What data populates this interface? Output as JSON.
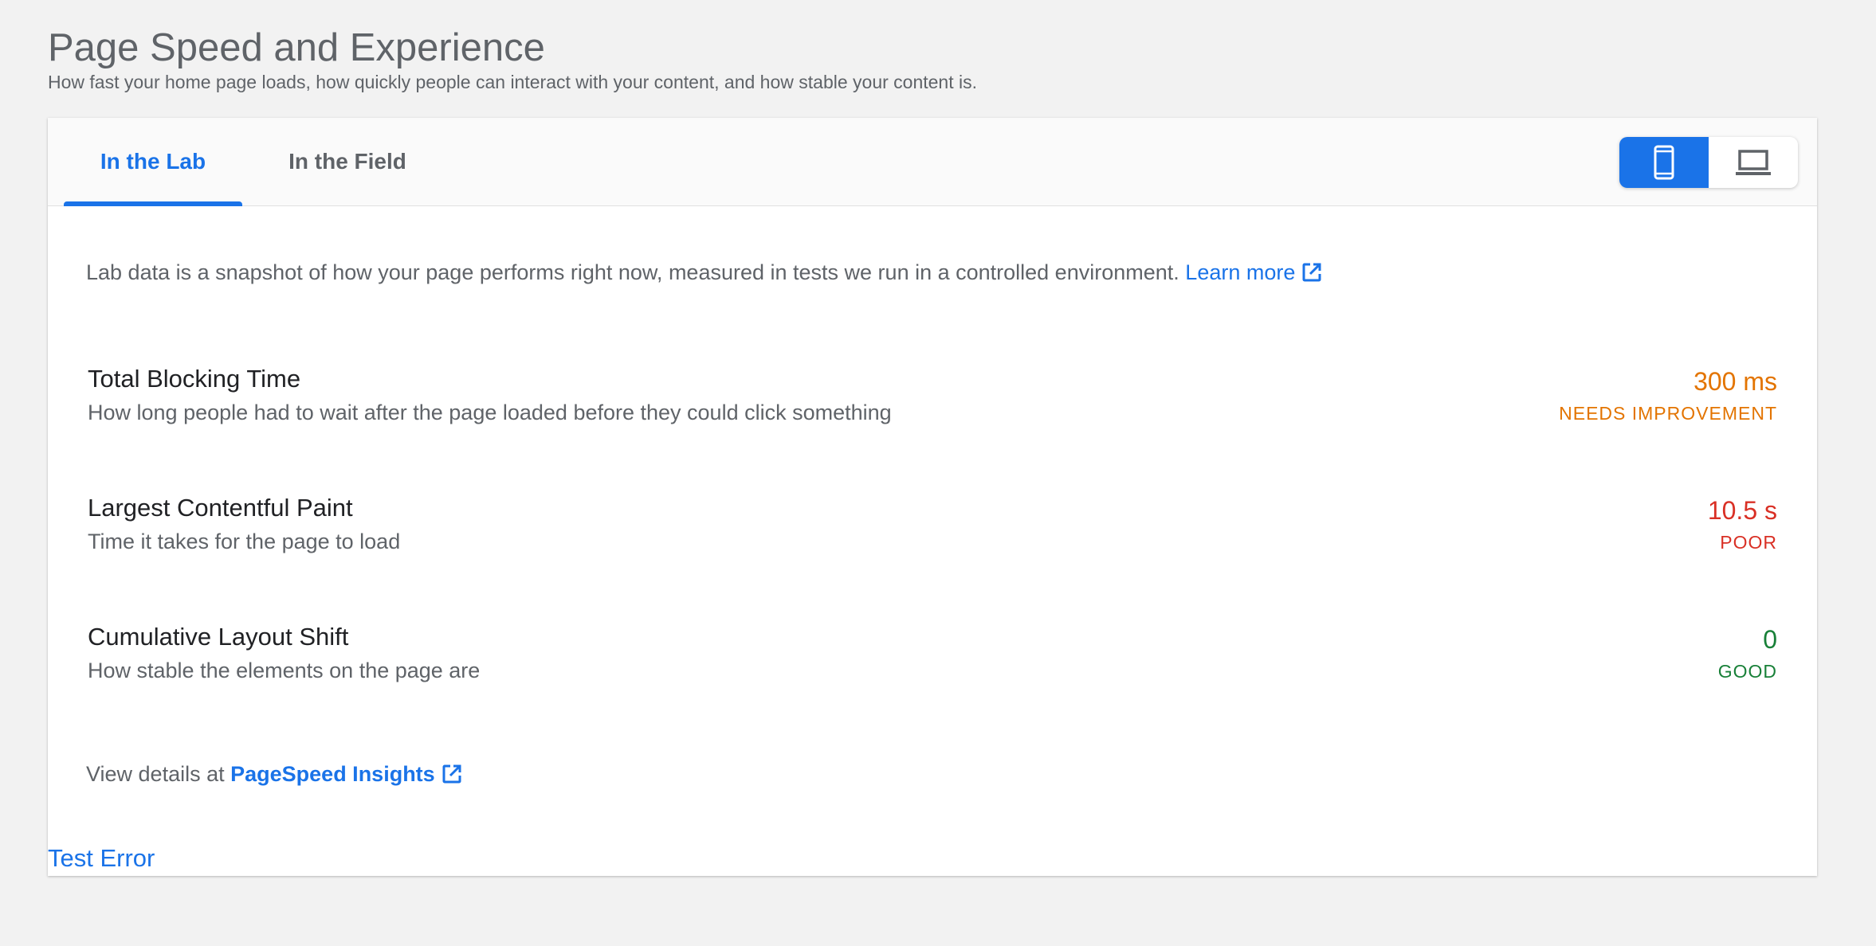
{
  "header": {
    "title": "Page Speed and Experience",
    "subtitle": "How fast your home page loads, how quickly people can interact with your content, and how stable your content is."
  },
  "tabs": [
    {
      "label": "In the Lab",
      "active": true
    },
    {
      "label": "In the Field",
      "active": false
    }
  ],
  "device_toggle": {
    "selected": "mobile",
    "options": [
      "mobile-icon",
      "laptop-icon"
    ]
  },
  "intro": {
    "text": "Lab data is a snapshot of how your page performs right now, measured in tests we run in a controlled environment.",
    "link_label": "Learn more"
  },
  "metrics": [
    {
      "name": "Total Blocking Time",
      "description": "How long people had to wait after the page loaded before they could click something",
      "value": "300 ms",
      "status": "NEEDS IMPROVEMENT",
      "color": "#e37400"
    },
    {
      "name": "Largest Contentful Paint",
      "description": "Time it takes for the page to load",
      "value": "10.5 s",
      "status": "POOR",
      "color": "#d93025"
    },
    {
      "name": "Cumulative Layout Shift",
      "description": "How stable the elements on the page are",
      "value": "0",
      "status": "GOOD",
      "color": "#188038"
    }
  ],
  "details": {
    "prefix": "View details at",
    "link_label": "PageSpeed Insights"
  },
  "error_link": "Test Error",
  "colors": {
    "accent": "#1a73e8",
    "background": "#f2f2f2"
  }
}
